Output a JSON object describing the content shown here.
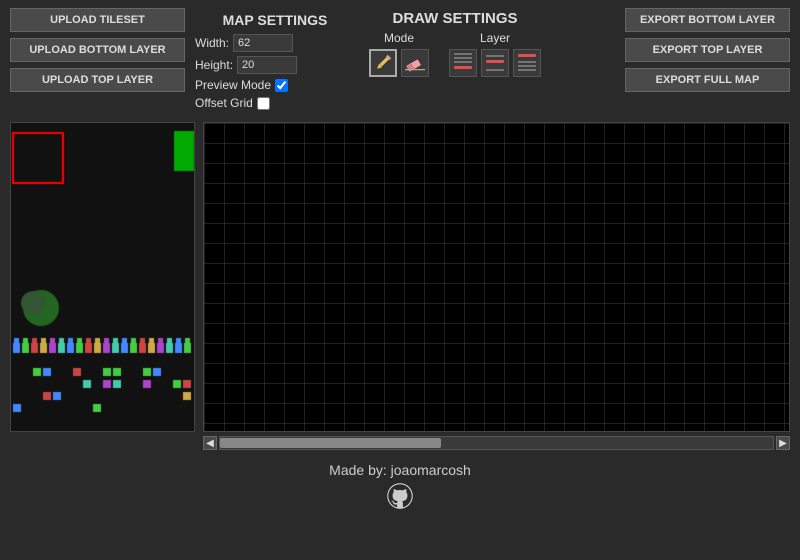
{
  "topBar": {
    "title": "MAP SETTINGS",
    "drawTitle": "DRAW SETTINGS",
    "buttons": {
      "uploadTileset": "UPLOAD TILESET",
      "uploadBottomLayer": "UPLOAD BOTTOM LAYER",
      "uploadTopLayer": "UPLOAD TOP LAYER",
      "exportBottomLayer": "EXPORT BOTTOM LAYER",
      "exportTopLayer": "EXPORT TOP LAYER",
      "exportFullMap": "EXPORT FULL MAP"
    },
    "mapSettings": {
      "widthLabel": "Width:",
      "widthValue": "62",
      "heightLabel": "Height:",
      "heightValue": "20",
      "previewModeLabel": "Preview Mode",
      "offsetGridLabel": "Offset Grid"
    },
    "drawSettings": {
      "modeLabel": "Mode",
      "layerLabel": "Layer"
    }
  },
  "footer": {
    "madeBy": "Made by: joaomarcosh"
  }
}
